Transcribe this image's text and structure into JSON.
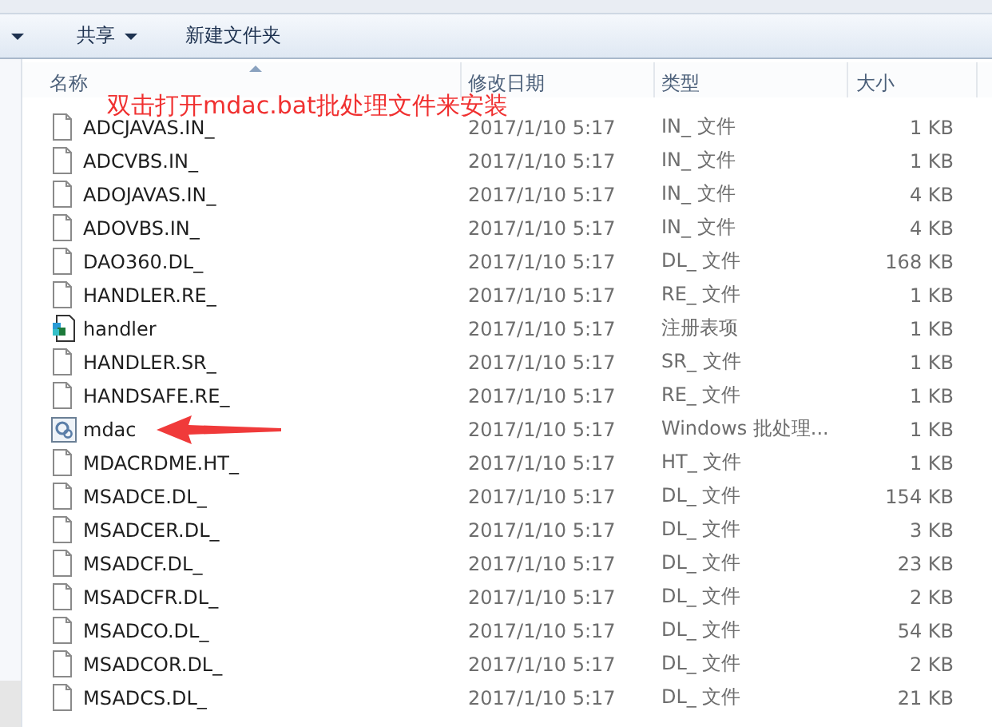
{
  "toolbar": {
    "buttons": [
      {
        "label": "共享",
        "dropdown": true
      },
      {
        "label": "新建文件夹",
        "dropdown": false
      }
    ]
  },
  "columns": [
    {
      "label": "名称",
      "sorted": true
    },
    {
      "label": "修改日期",
      "sorted": false
    },
    {
      "label": "类型",
      "sorted": false
    },
    {
      "label": "大小",
      "sorted": false
    }
  ],
  "annotation": {
    "text": "双击打开mdac.bat批处理文件来安装"
  },
  "files": [
    {
      "name": "ADCJAVAS.IN_",
      "kind": "file",
      "date": "2017/1/10 5:17",
      "type": "IN_ 文件",
      "size": "1 KB"
    },
    {
      "name": "ADCVBS.IN_",
      "kind": "file",
      "date": "2017/1/10 5:17",
      "type": "IN_ 文件",
      "size": "1 KB"
    },
    {
      "name": "ADOJAVAS.IN_",
      "kind": "file",
      "date": "2017/1/10 5:17",
      "type": "IN_ 文件",
      "size": "4 KB"
    },
    {
      "name": "ADOVBS.IN_",
      "kind": "file",
      "date": "2017/1/10 5:17",
      "type": "IN_ 文件",
      "size": "4 KB"
    },
    {
      "name": "DAO360.DL_",
      "kind": "file",
      "date": "2017/1/10 5:17",
      "type": "DL_ 文件",
      "size": "168 KB"
    },
    {
      "name": "HANDLER.RE_",
      "kind": "file",
      "date": "2017/1/10 5:17",
      "type": "RE_ 文件",
      "size": "1 KB"
    },
    {
      "name": "handler",
      "kind": "registry",
      "date": "2017/1/10 5:17",
      "type": "注册表项",
      "size": "1 KB"
    },
    {
      "name": "HANDLER.SR_",
      "kind": "file",
      "date": "2017/1/10 5:17",
      "type": "SR_ 文件",
      "size": "1 KB"
    },
    {
      "name": "HANDSAFE.RE_",
      "kind": "file",
      "date": "2017/1/10 5:17",
      "type": "RE_ 文件",
      "size": "1 KB"
    },
    {
      "name": "mdac",
      "kind": "batch",
      "date": "2017/1/10 5:17",
      "type": "Windows 批处理...",
      "size": "1 KB",
      "pointed": true
    },
    {
      "name": "MDACRDME.HT_",
      "kind": "file",
      "date": "2017/1/10 5:17",
      "type": "HT_ 文件",
      "size": "1 KB"
    },
    {
      "name": "MSADCE.DL_",
      "kind": "file",
      "date": "2017/1/10 5:17",
      "type": "DL_ 文件",
      "size": "154 KB"
    },
    {
      "name": "MSADCER.DL_",
      "kind": "file",
      "date": "2017/1/10 5:17",
      "type": "DL_ 文件",
      "size": "3 KB"
    },
    {
      "name": "MSADCF.DL_",
      "kind": "file",
      "date": "2017/1/10 5:17",
      "type": "DL_ 文件",
      "size": "23 KB"
    },
    {
      "name": "MSADCFR.DL_",
      "kind": "file",
      "date": "2017/1/10 5:17",
      "type": "DL_ 文件",
      "size": "2 KB"
    },
    {
      "name": "MSADCO.DL_",
      "kind": "file",
      "date": "2017/1/10 5:17",
      "type": "DL_ 文件",
      "size": "54 KB"
    },
    {
      "name": "MSADCOR.DL_",
      "kind": "file",
      "date": "2017/1/10 5:17",
      "type": "DL_ 文件",
      "size": "2 KB"
    },
    {
      "name": "MSADCS.DL_",
      "kind": "file",
      "date": "2017/1/10 5:17",
      "type": "DL_ 文件",
      "size": "21 KB"
    }
  ]
}
